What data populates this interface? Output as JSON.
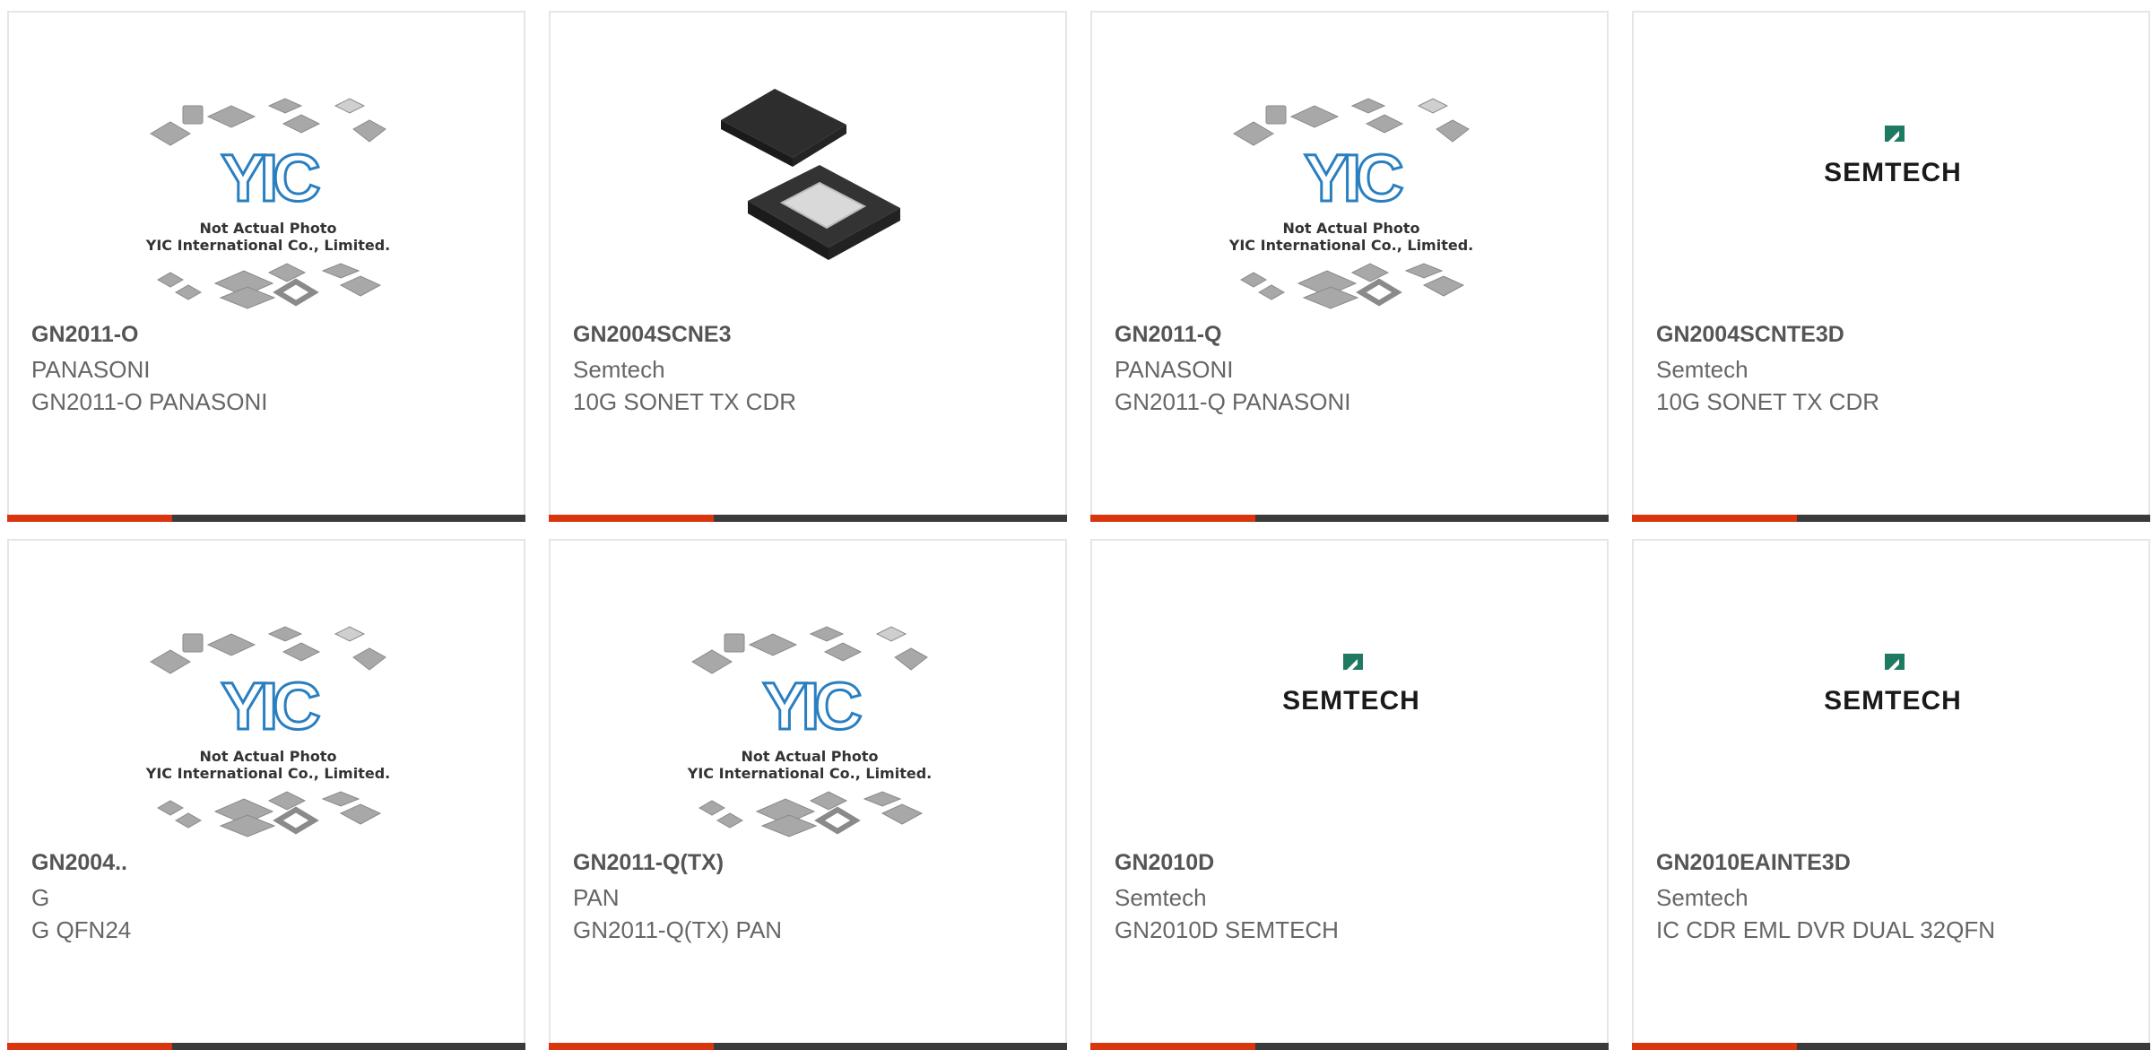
{
  "products": [
    {
      "part": "GN2011-O",
      "brand": "PANASONI",
      "desc": "GN2011-O PANASONI",
      "image": "yic-placeholder"
    },
    {
      "part": "GN2004SCNE3",
      "brand": "Semtech",
      "desc": "10G SONET TX CDR",
      "image": "qfn-chip"
    },
    {
      "part": "GN2011-Q",
      "brand": "PANASONI",
      "desc": "GN2011-Q PANASONI",
      "image": "yic-placeholder"
    },
    {
      "part": "GN2004SCNTE3D",
      "brand": "Semtech",
      "desc": "10G SONET TX CDR",
      "image": "semtech-logo"
    },
    {
      "part": "GN2004..",
      "brand": "G",
      "desc": "G QFN24",
      "image": "yic-placeholder"
    },
    {
      "part": "GN2011-Q(TX)",
      "brand": "PAN",
      "desc": "GN2011-Q(TX) PAN",
      "image": "yic-placeholder"
    },
    {
      "part": "GN2010D",
      "brand": "Semtech",
      "desc": "GN2010D SEMTECH",
      "image": "semtech-logo"
    },
    {
      "part": "GN2010EAINTE3D",
      "brand": "Semtech",
      "desc": "IC CDR EML DVR DUAL 32QFN",
      "image": "semtech-logo"
    }
  ],
  "placeholder": {
    "logo_text": "YIC",
    "line1": "Not Actual Photo",
    "line2": "YIC International Co., Limited."
  },
  "semtech_logo_text": "SEMTECH",
  "colors": {
    "accent": "#d9350f",
    "bar": "#3b3b3b",
    "yic_blue": "#2a7fc0",
    "semtech_green": "#1f7a63"
  }
}
